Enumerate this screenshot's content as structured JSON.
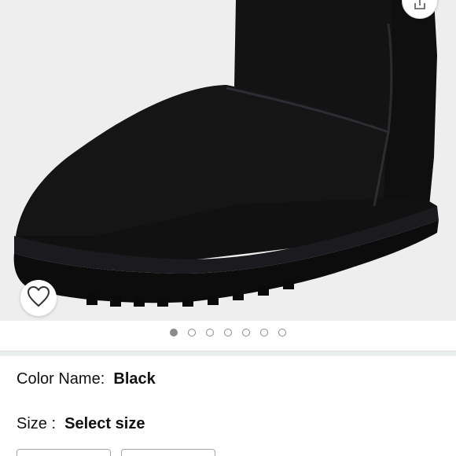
{
  "product": {
    "image_alt": "Black suede mini boot",
    "carousel": {
      "total": 7,
      "active_index": 0
    }
  },
  "actions": {
    "share_icon": "share-icon",
    "wishlist_icon": "heart-outline-icon"
  },
  "color": {
    "label": "Color Name:",
    "value": "Black"
  },
  "size": {
    "label": "Size :",
    "value": "Select size"
  },
  "colors": {
    "image_bg": "#eeeeee",
    "divider": "#eaeded",
    "text": "#111111",
    "dot": "#8a8a8a"
  }
}
